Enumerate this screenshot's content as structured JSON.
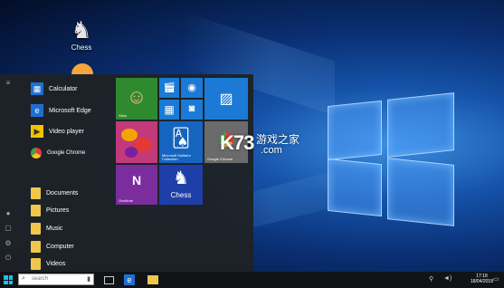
{
  "desktop": {
    "icons": [
      {
        "label": "Chess",
        "icon": "chess-knight-icon"
      }
    ]
  },
  "start_menu": {
    "apps": [
      {
        "label": "Calculator",
        "icon": "calculator-icon",
        "color": "#1f6fd1"
      },
      {
        "label": "Microsoft Edge",
        "icon": "edge-icon",
        "color": "#1f6fd1"
      },
      {
        "label": "Video player",
        "icon": "video-player-icon",
        "color": "#f2c200"
      },
      {
        "label": "Google Chrome",
        "icon": "chrome-icon",
        "color": "#e53935"
      },
      {
        "label": "Documents",
        "icon": "folder-icon",
        "color": "#f0c64b"
      },
      {
        "label": "Pictures",
        "icon": "folder-icon",
        "color": "#f0c64b"
      },
      {
        "label": "Music",
        "icon": "folder-icon",
        "color": "#f0c64b"
      },
      {
        "label": "Computer",
        "icon": "folder-icon",
        "color": "#f0c64b"
      },
      {
        "label": "Videos",
        "icon": "folder-icon",
        "color": "#f0c64b"
      }
    ],
    "tiles": {
      "xbox": {
        "label": "Xbox",
        "color": "#2f8a2f"
      },
      "candy": {
        "label": "",
        "color": "#c23a7a"
      },
      "solitaire": {
        "label": "Microsoft Solitaire Collection",
        "color": "#1565c0"
      },
      "chrome": {
        "label": "Google Chrome",
        "color": "#6b6b6b"
      },
      "onenote": {
        "label": "OneNote",
        "color": "#7b2d9e"
      },
      "chess": {
        "label": "Chess",
        "color": "#1e3fa8"
      },
      "small_color": "#1a7ad6"
    }
  },
  "watermark": {
    "brand": "K73",
    "cn": "游戏之家",
    "domain": ".com"
  },
  "taskbar": {
    "search_placeholder": "search",
    "clock_time": "17:18",
    "clock_date": "18/04/2018"
  }
}
